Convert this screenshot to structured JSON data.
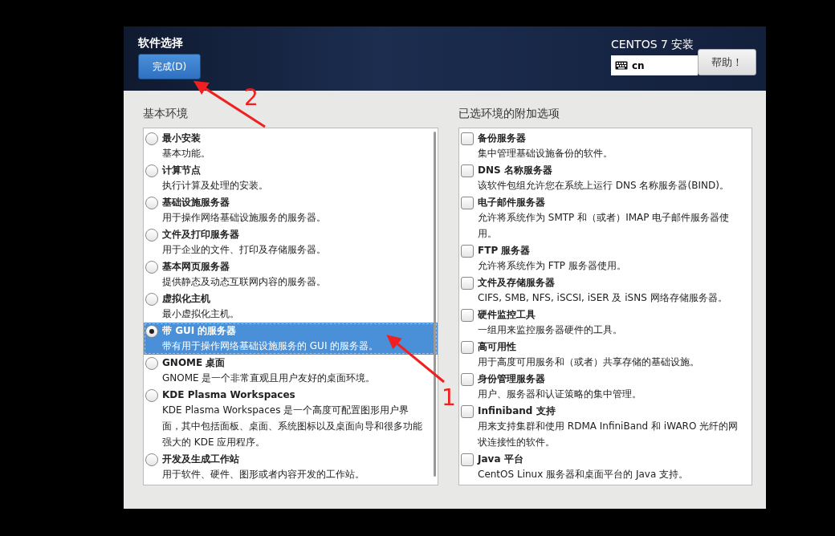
{
  "header": {
    "title": "软件选择",
    "done_button": "完成(D)",
    "product": "CENTOS 7 安装",
    "keyboard_layout": "cn",
    "help_button": "帮助！"
  },
  "environments": {
    "heading": "基本环境",
    "items": [
      {
        "title": "最小安装",
        "description": "基本功能。",
        "selected": false
      },
      {
        "title": "计算节点",
        "description": "执行计算及处理的安装。",
        "selected": false
      },
      {
        "title": "基础设施服务器",
        "description": "用于操作网络基础设施服务的服务器。",
        "selected": false
      },
      {
        "title": "文件及打印服务器",
        "description": "用于企业的文件、打印及存储服务器。",
        "selected": false
      },
      {
        "title": "基本网页服务器",
        "description": "提供静态及动态互联网内容的服务器。",
        "selected": false
      },
      {
        "title": "虚拟化主机",
        "description": "最小虚拟化主机。",
        "selected": false
      },
      {
        "title": "带 GUI 的服务器",
        "description": "带有用于操作网络基础设施服务的 GUI 的服务器。",
        "selected": true
      },
      {
        "title": "GNOME 桌面",
        "description": "GNOME 是一个非常直观且用户友好的桌面环境。",
        "selected": false
      },
      {
        "title": "KDE Plasma Workspaces",
        "description": "KDE Plasma Workspaces 是一个高度可配置图形用户界面，其中包括面板、桌面、系统图标以及桌面向导和很多功能强大的 KDE 应用程序。",
        "selected": false
      },
      {
        "title": "开发及生成工作站",
        "description": "用于软件、硬件、图形或者内容开发的工作站。",
        "selected": false
      }
    ]
  },
  "addons": {
    "heading": "已选环境的附加选项",
    "items": [
      {
        "title": "备份服务器",
        "description": "集中管理基础设施备份的软件。",
        "checked": false
      },
      {
        "title": "DNS 名称服务器",
        "description": "该软件包组允许您在系统上运行 DNS 名称服务器(BIND)。",
        "checked": false
      },
      {
        "title": "电子邮件服务器",
        "description": "允许将系统作为 SMTP 和（或者）IMAP 电子邮件服务器使用。",
        "checked": false
      },
      {
        "title": "FTP 服务器",
        "description": "允许将系统作为 FTP 服务器使用。",
        "checked": false
      },
      {
        "title": "文件及存储服务器",
        "description": "CIFS, SMB, NFS, iSCSI, iSER 及 iSNS 网络存储服务器。",
        "checked": false
      },
      {
        "title": "硬件监控工具",
        "description": "一组用来监控服务器硬件的工具。",
        "checked": false
      },
      {
        "title": "高可用性",
        "description": "用于高度可用服务和（或者）共享存储的基础设施。",
        "checked": false
      },
      {
        "title": "身份管理服务器",
        "description": "用户、服务器和认证策略的集中管理。",
        "checked": false
      },
      {
        "title": "Infiniband 支持",
        "description": "用来支持集群和使用 RDMA InfiniBand 和 iWARO 光纤的网状连接性的软件。",
        "checked": false
      },
      {
        "title": "Java 平台",
        "description": "CentOS Linux 服务器和桌面平台的 Java 支持。",
        "checked": false
      }
    ]
  },
  "annotations": [
    {
      "label": "2"
    },
    {
      "label": "1"
    }
  ]
}
